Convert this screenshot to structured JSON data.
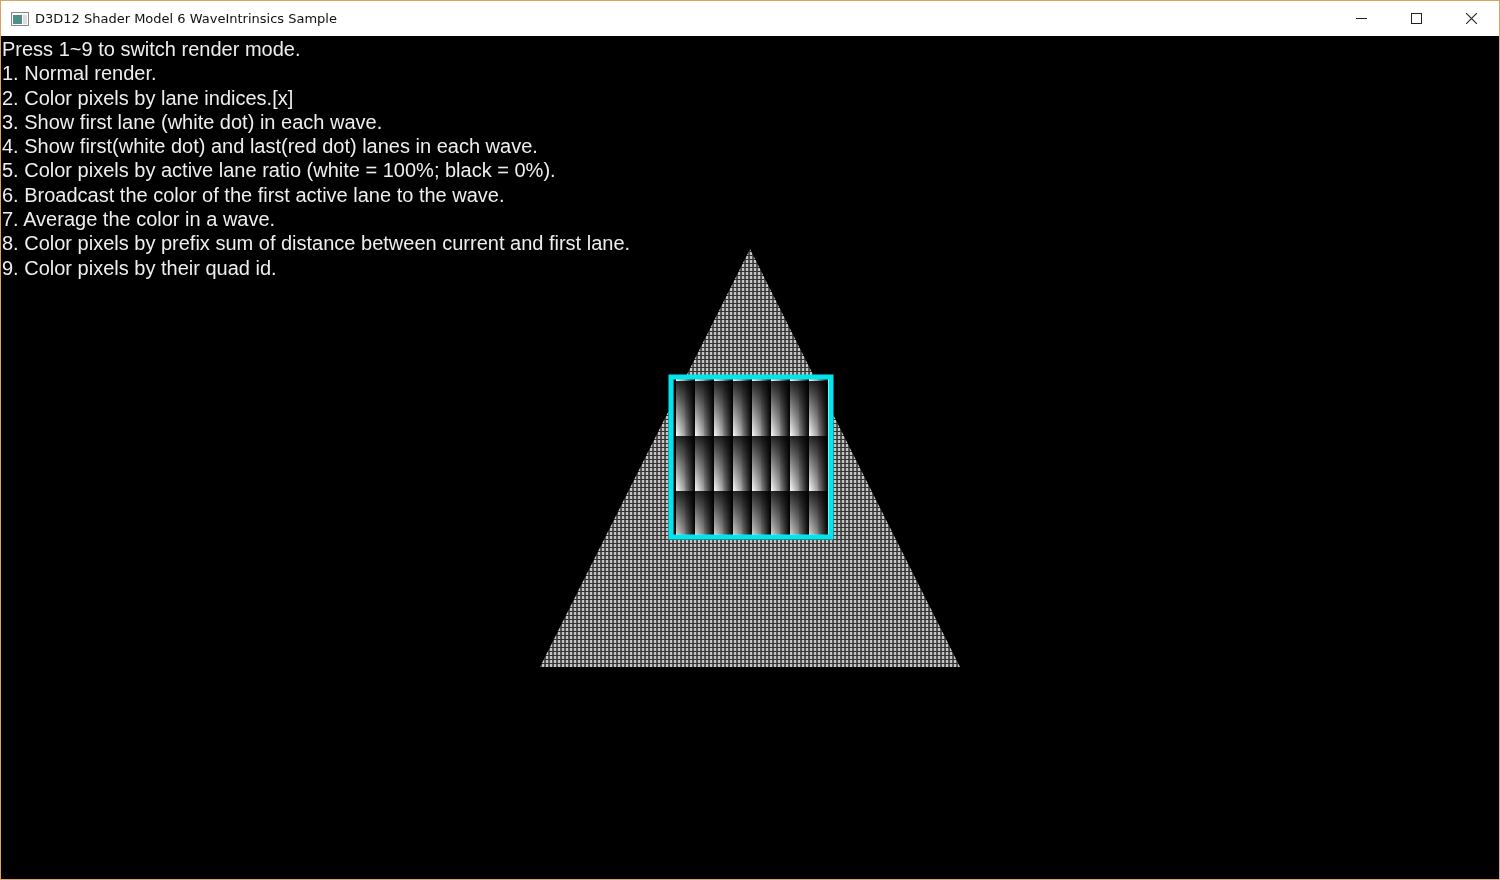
{
  "window": {
    "title": "D3D12 Shader Model 6 WaveIntrinsics Sample"
  },
  "instructions": [
    "Press 1~9 to switch render mode.",
    "1. Normal render.",
    "2. Color pixels by lane indices.[x]",
    "3. Show first lane (white dot) in each wave.",
    "4. Show first(white dot) and last(red dot) lanes in each wave.",
    "5. Color pixels by active lane ratio (white = 100%; black = 0%).",
    "6. Broadcast the color of the first active lane to the wave.",
    "7. Average the color in a wave.",
    "8. Color pixels by prefix sum of distance between current and first lane.",
    "9. Color pixels by their quad id."
  ]
}
